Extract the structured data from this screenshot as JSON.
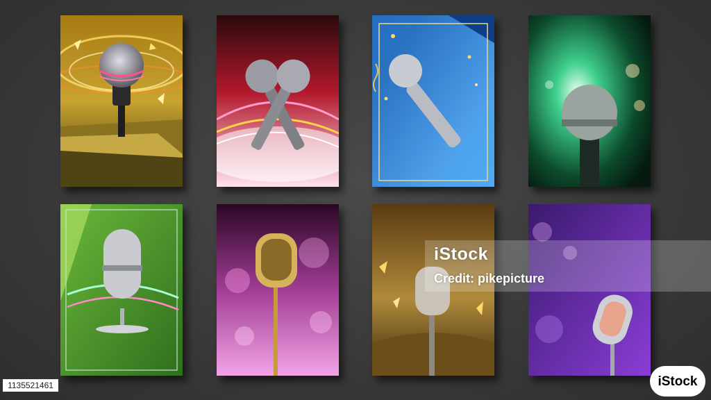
{
  "posters": [
    {
      "id": "p1",
      "theme": "golden stage with sparkle rings, mic on stand"
    },
    {
      "id": "p2",
      "theme": "red crossed microphones with light arcs"
    },
    {
      "id": "p3",
      "theme": "blue polygonal background with confetti and gold frame"
    },
    {
      "id": "p4",
      "theme": "green spotlight burst with bokeh"
    },
    {
      "id": "p5",
      "theme": "green curtain with retro microphone and neon swirl"
    },
    {
      "id": "p6",
      "theme": "purple bokeh with golden retro microphone"
    },
    {
      "id": "p7",
      "theme": "gold stage with shards and retro microphone"
    },
    {
      "id": "p8",
      "theme": "violet bokeh with chrome retro microphone"
    }
  ],
  "watermark": {
    "brand": "iStock",
    "credit": "Credit: pikepicture"
  },
  "image_id": "1135521461",
  "logo_text": "iStock",
  "colors": {
    "background": "#3a3a3a",
    "watermark_band": "rgba(255,255,255,0.22)"
  }
}
